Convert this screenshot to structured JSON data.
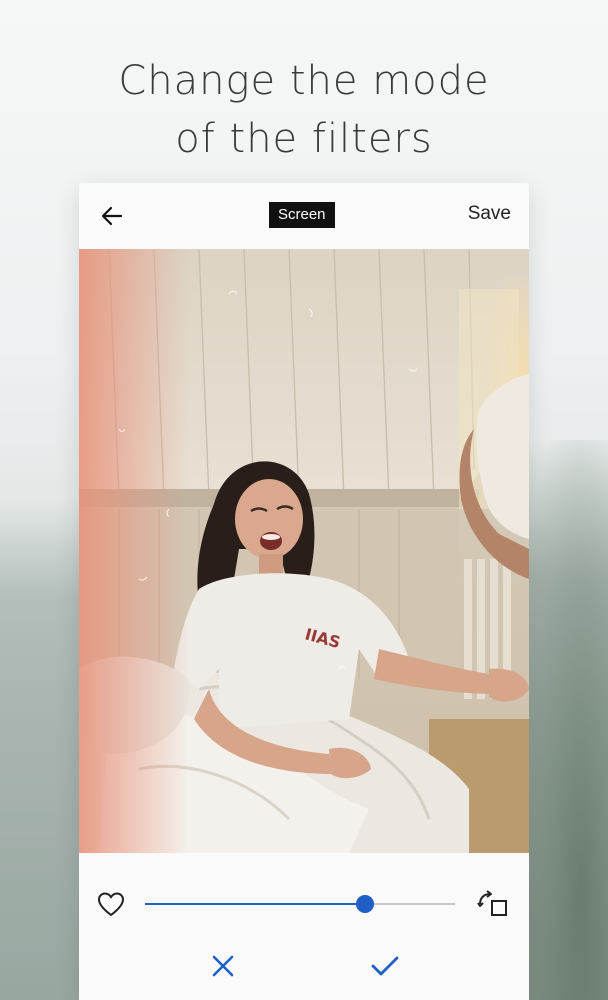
{
  "headline": {
    "line1": "Change the mode",
    "line2": "of the filters"
  },
  "topbar": {
    "back_icon": "arrow-left-icon",
    "mode_label": "Screen",
    "save_label": "Save"
  },
  "photo": {
    "description_icon": "photo-preview"
  },
  "controls": {
    "heart_icon": "heart-outline-icon",
    "intensity_fraction": 0.71,
    "mode_toggle_icon": "rotate-square-icon",
    "cancel_icon": "close-icon",
    "apply_icon": "check-icon"
  },
  "colors": {
    "accent": "#1f5fc6",
    "badge_bg": "#111111",
    "badge_text": "#ffffff"
  }
}
